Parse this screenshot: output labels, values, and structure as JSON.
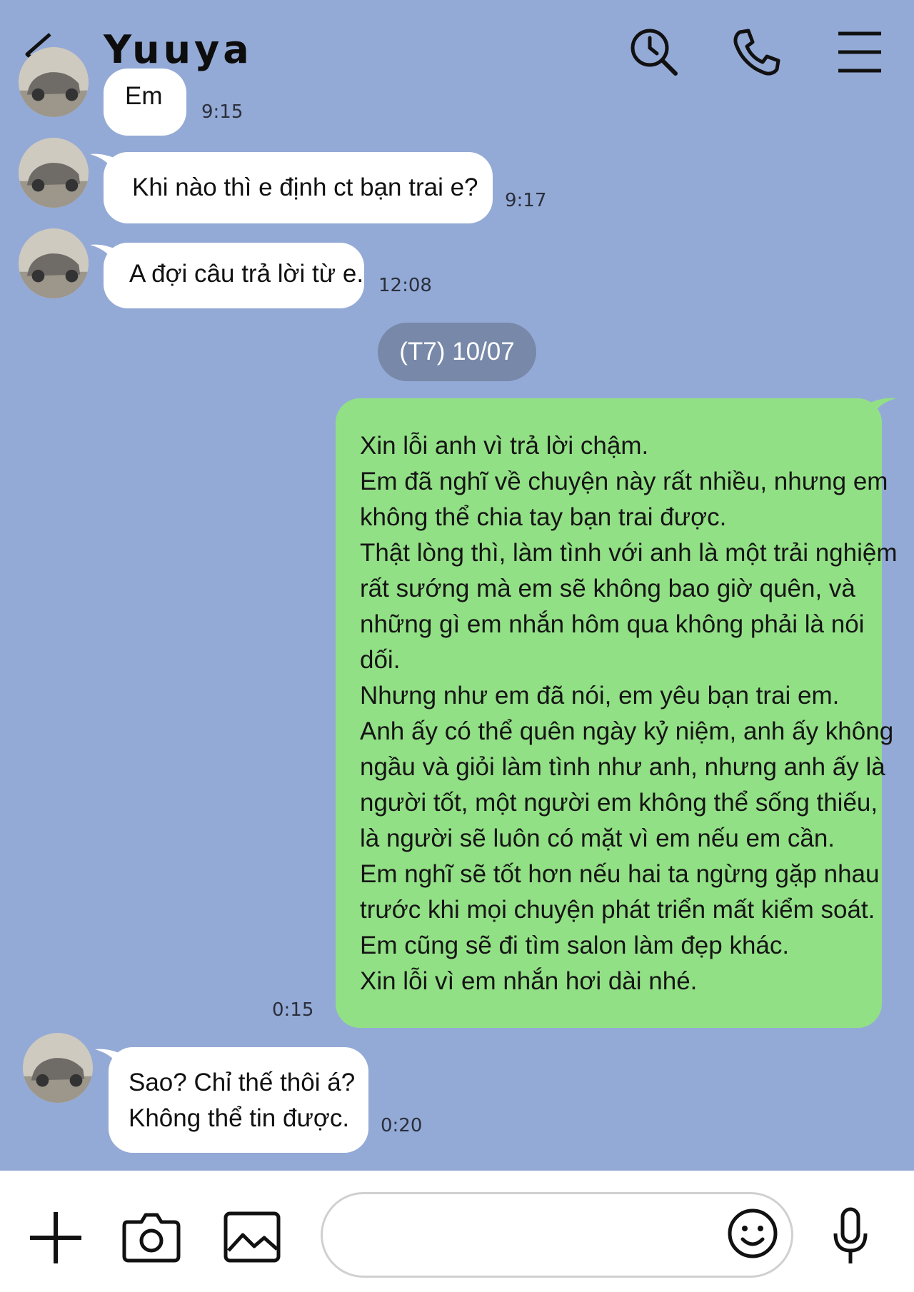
{
  "header": {
    "title": "Yuuya",
    "icons": [
      "back-icon",
      "search-icon",
      "phone-icon",
      "menu-icon"
    ]
  },
  "messages": [
    {
      "side": "incoming",
      "text": [
        "Em"
      ],
      "time": "9:15"
    },
    {
      "side": "incoming",
      "text": [
        "Khi nào thì e định ct bạn trai e?"
      ],
      "time": "9:17"
    },
    {
      "side": "incoming",
      "text": [
        "A đợi câu trả lời từ e."
      ],
      "time": "12:08"
    },
    {
      "side": "outgoing",
      "text": [
        "Xin lỗi anh vì trả lời chậm.",
        "Em đã nghĩ về chuyện này rất nhiều, nhưng em",
        "không thể chia tay bạn trai được.",
        "Thật lòng thì, làm tình với anh là một trải nghiệm",
        "rất sướng mà em sẽ không bao giờ quên, và",
        "những gì em nhắn hôm qua không phải là nói",
        "dối.",
        "Nhưng như em đã nói, em yêu bạn trai em.",
        "Anh ấy có thể quên ngày kỷ niệm, anh ấy không",
        "ngầu và giỏi làm tình như anh, nhưng anh ấy là",
        "người tốt, một người em không thể sống thiếu,",
        "là người sẽ luôn có mặt vì em nếu em cần.",
        "Em nghĩ sẽ tốt hơn nếu hai ta ngừng gặp nhau",
        "trước khi mọi chuyện phát triển mất kiểm soát.",
        "Em cũng sẽ đi tìm salon làm đẹp khác.",
        "Xin lỗi vì em nhắn hơi dài nhé."
      ],
      "time": "0:15"
    },
    {
      "side": "incoming",
      "text": [
        "Sao? Chỉ thế thôi á?",
        "Không thể tin được."
      ],
      "time": "0:20"
    }
  ],
  "date_separator": "(T7) 10/07",
  "composer": {
    "icons": [
      "plus-icon",
      "camera-icon",
      "image-icon",
      "emoji-icon",
      "microphone-icon"
    ],
    "input_value": "",
    "input_placeholder": ""
  },
  "colors": {
    "background": "#94aad6",
    "incoming_bubble": "#ffffff",
    "outgoing_bubble": "#92e085",
    "date_pill": "#7788a8",
    "composer_bar": "#ffffff"
  }
}
